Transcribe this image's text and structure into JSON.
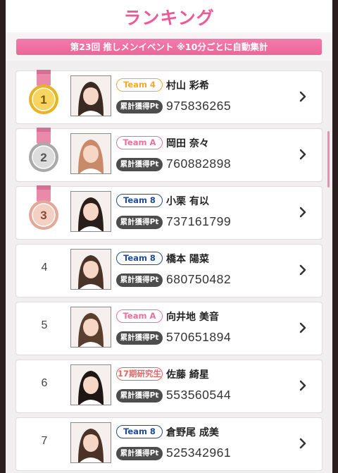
{
  "header": {
    "title": "ランキング"
  },
  "event": {
    "banner_text": "第23回 推しメンイベント ※10分ごとに自動集計"
  },
  "colors": {
    "accent": "#ee5a96",
    "team4": "#f4a830",
    "teamA": "#e8709e",
    "team8": "#1f4b93",
    "trainee": "#e06666"
  },
  "points_label": "累計獲得Pt",
  "rankings": [
    {
      "rank": "1",
      "medal": "gold-medal-icon",
      "team": "Team 4",
      "team_color": "#f4a830",
      "name": "村山 彩希",
      "points": "975836265"
    },
    {
      "rank": "2",
      "medal": "silver-medal-icon",
      "team": "Team A",
      "team_color": "#e8709e",
      "name": "岡田 奈々",
      "points": "760882898"
    },
    {
      "rank": "3",
      "medal": "bronze-medal-icon",
      "team": "Team 8",
      "team_color": "#1f4b93",
      "name": "小栗 有以",
      "points": "737161799"
    },
    {
      "rank": "4",
      "team": "Team 8",
      "team_color": "#1f4b93",
      "name": "橋本 陽菜",
      "points": "680750482"
    },
    {
      "rank": "5",
      "team": "Team A",
      "team_color": "#e8709e",
      "name": "向井地 美音",
      "points": "570651894"
    },
    {
      "rank": "6",
      "team": "17期研究生",
      "team_color": "#e06666",
      "name": "佐藤 綺星",
      "points": "553560544"
    },
    {
      "rank": "7",
      "team": "Team 8",
      "team_color": "#1f4b93",
      "name": "倉野尾 成美",
      "points": "525342961"
    }
  ]
}
